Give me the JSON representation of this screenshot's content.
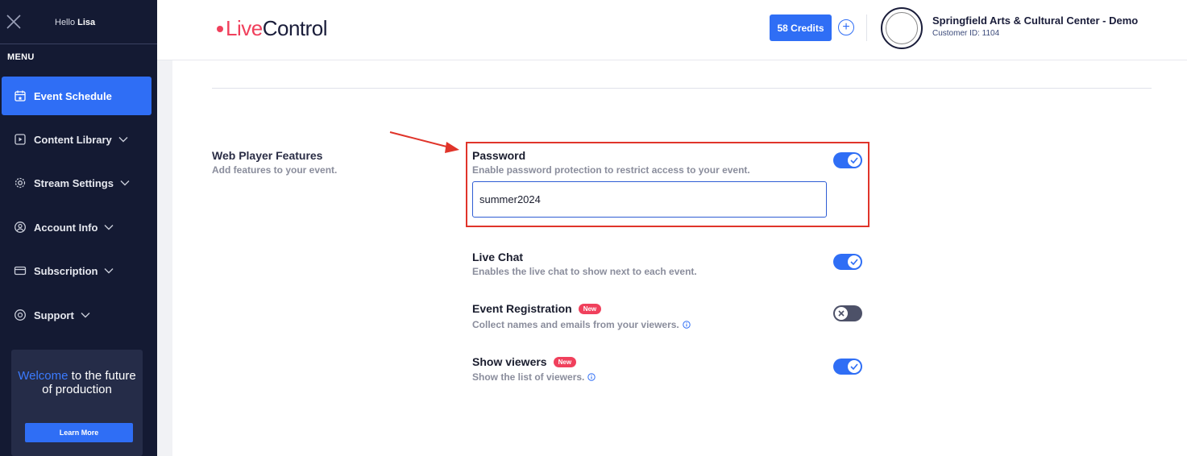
{
  "sidebar": {
    "greeting": "Hello",
    "user": "Lisa",
    "menu_label": "MENU",
    "items": [
      {
        "label": "Event Schedule",
        "icon": "calendar-star-icon",
        "active": true
      },
      {
        "label": "Content Library",
        "icon": "play-square-icon"
      },
      {
        "label": "Stream Settings",
        "icon": "gear-icon"
      },
      {
        "label": "Account Info",
        "icon": "user-circle-icon"
      },
      {
        "label": "Subscription",
        "icon": "credit-card-icon"
      },
      {
        "label": "Support",
        "icon": "question-circle-icon"
      }
    ],
    "promo": {
      "accent": "Welcome",
      "rest": " to the future of production",
      "button": "Learn More"
    }
  },
  "header": {
    "logo_live": "Live",
    "logo_control": "Control",
    "credits": "58 Credits",
    "plus": "+",
    "org_name": "Springfield Arts & Cultural Center - Demo",
    "customer_id": "Customer ID: 1104"
  },
  "section": {
    "title": "Web Player Features",
    "subtitle": "Add features to your event."
  },
  "features": [
    {
      "title": "Password",
      "subtitle": "Enable password protection to restrict access to your event.",
      "enabled": true,
      "value": "summer2024"
    },
    {
      "title": "Live Chat",
      "subtitle": "Enables the live chat to show next to each event.",
      "enabled": true
    },
    {
      "title": "Event Registration",
      "badge": "New",
      "subtitle": "Collect names and emails from your viewers.",
      "enabled": false
    },
    {
      "title": "Show viewers",
      "badge": "New",
      "subtitle": "Show the list of viewers.",
      "enabled": true
    }
  ],
  "colors": {
    "sidebar_bg": "#141a33",
    "accent_blue": "#2f6ef5",
    "brand_red": "#f0405c",
    "highlight": "#e0342a"
  }
}
